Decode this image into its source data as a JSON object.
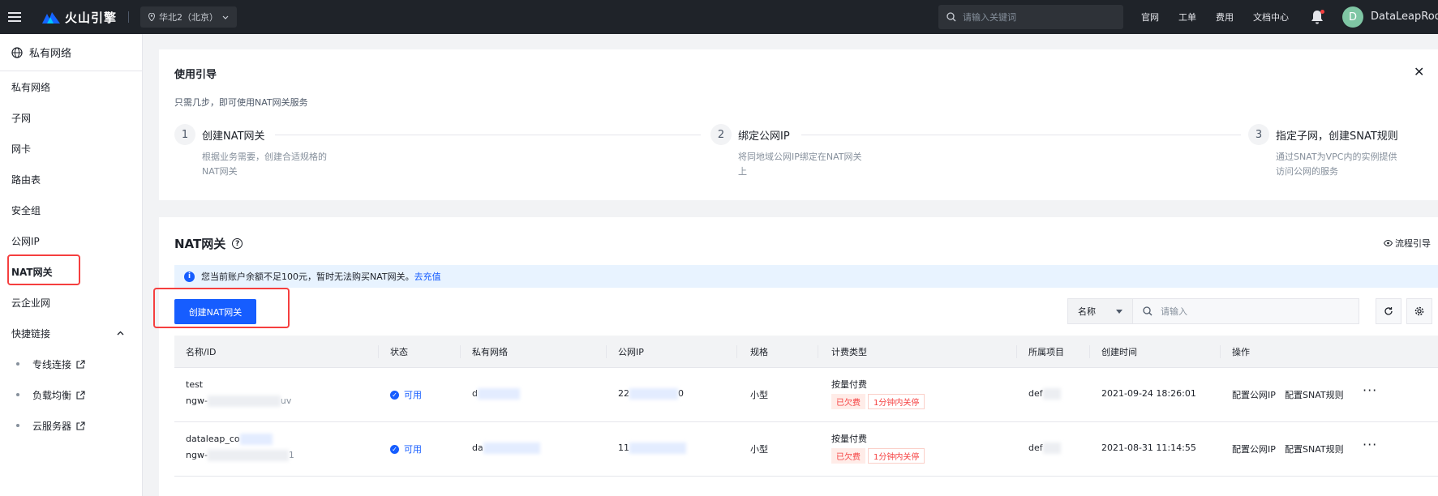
{
  "topbar": {
    "brand": "火山引擎",
    "region": "华北2（北京）",
    "search_placeholder": "请输入关键词",
    "links": [
      "官网",
      "工单",
      "费用",
      "文档中心"
    ],
    "avatar_letter": "D",
    "username": "DataLeapRoc"
  },
  "sidebar": {
    "title": "私有网络",
    "items": [
      "私有网络",
      "子网",
      "网卡",
      "路由表",
      "安全组",
      "公网IP",
      "NAT网关",
      "云企业网"
    ],
    "active": "NAT网关",
    "shortcut_label": "快捷链接",
    "shortcuts": [
      "专线连接",
      "负载均衡",
      "云服务器"
    ]
  },
  "guide": {
    "title": "使用引导",
    "subtitle": "只需几步，即可使用NAT网关服务",
    "steps": [
      {
        "num": "1",
        "title": "创建NAT网关",
        "desc": "根据业务需要，创建合适规格的NAT网关"
      },
      {
        "num": "2",
        "title": "绑定公网IP",
        "desc": "将同地域公网IP绑定在NAT网关上"
      },
      {
        "num": "3",
        "title": "指定子网，创建SNAT规则",
        "desc": "通过SNAT为VPC内的实例提供访问公网的服务"
      }
    ]
  },
  "nat": {
    "title": "NAT网关",
    "flow_guide": "流程引导",
    "alert_text": "您当前账户余额不足100元，暂时无法购买NAT网关。",
    "alert_link": "去充值",
    "create_button": "创建NAT网关",
    "filter_select": "名称",
    "filter_placeholder": "请输入"
  },
  "table": {
    "headers": [
      "名称/ID",
      "状态",
      "私有网络",
      "公网IP",
      "规格",
      "计费类型",
      "所属项目",
      "创建时间",
      "操作"
    ],
    "rows": [
      {
        "name": "test",
        "id_prefix": "ngw-",
        "id_suffix": "uv",
        "status": "可用",
        "vpc": "d",
        "public_ip_start": "22",
        "public_ip_end": "0",
        "spec": "小型",
        "billing": "按量付费",
        "tag_overdue": "已欠费",
        "tag_shutdown": "1分钟内关停",
        "project": "def",
        "created": "2021-09-24 18:26:01",
        "action_ip": "配置公网IP",
        "action_snat": "配置SNAT规则"
      },
      {
        "name": "dataleap_co",
        "id_prefix": "ngw-",
        "id_suffix": "1",
        "status": "可用",
        "vpc": "da",
        "public_ip_start": "11",
        "public_ip_end": "",
        "spec": "小型",
        "billing": "按量付费",
        "tag_overdue": "已欠费",
        "tag_shutdown": "1分钟内关停",
        "project": "def",
        "created": "2021-08-31 11:14:55",
        "action_ip": "配置公网IP",
        "action_snat": "配置SNAT规则"
      }
    ]
  },
  "colors": {
    "accent": "#165dff",
    "topbar": "#1f2329",
    "danger": "#f53f3f"
  }
}
